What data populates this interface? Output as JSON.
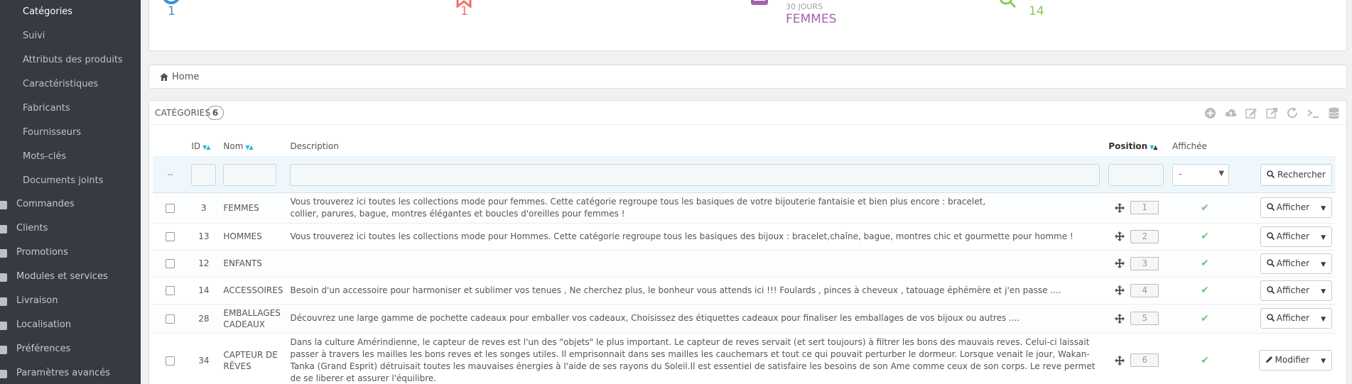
{
  "sidebar": {
    "sub_items": [
      {
        "label": "Catégories",
        "active": true
      },
      {
        "label": "Suivi"
      },
      {
        "label": "Attributs des produits"
      },
      {
        "label": "Caractéristiques"
      },
      {
        "label": "Fabricants"
      },
      {
        "label": "Fournisseurs"
      },
      {
        "label": "Mots-clés"
      },
      {
        "label": "Documents joints"
      }
    ],
    "main_items": [
      {
        "label": "Commandes"
      },
      {
        "label": "Clients"
      },
      {
        "label": "Promotions"
      },
      {
        "label": "Modules et services"
      },
      {
        "label": "Livraison"
      },
      {
        "label": "Localisation"
      },
      {
        "label": "Préférences"
      },
      {
        "label": "Paramètres avancés"
      }
    ]
  },
  "kpi": [
    {
      "icon": "circle-icon",
      "value": "1",
      "color": "#3e8fd0"
    },
    {
      "icon": "bookmark-icon",
      "value": "1",
      "color": "#f36d6b"
    },
    {
      "icon": "calendar-icon",
      "sub": "30 JOURS",
      "value": "FEMMES",
      "color": "#a264ac"
    },
    {
      "icon": "search-icon",
      "value": "14",
      "color": "#8bc954"
    }
  ],
  "breadcrumb": {
    "home": "Home"
  },
  "panel": {
    "title": "CATÉGORIES",
    "count": "6",
    "toolbar": [
      "add-icon",
      "cloud-upload-icon",
      "edit-icon",
      "export-icon",
      "refresh-icon",
      "terminal-icon",
      "database-icon"
    ]
  },
  "table": {
    "headers": {
      "id": "ID",
      "name": "Nom",
      "description": "Description",
      "position": "Position",
      "displayed": "Affichée"
    },
    "filter": {
      "dash": "--",
      "select_value": "-",
      "search_label": "Rechercher"
    },
    "rows": [
      {
        "id": "3",
        "name": "FEMMES",
        "description": "Vous trouverez ici toutes les collections mode pour femmes. Cette catégorie regroupe tous les basiques de votre bijouterie fantaisie et bien plus encore : bracelet, collier, parures, bague, montres élégantes et boucles d'oreilles pour femmes !",
        "position": "1",
        "action": "Afficher",
        "action_icon": "zoom-icon"
      },
      {
        "id": "13",
        "name": "HOMMES",
        "description": "Vous trouverez ici toutes les collections mode pour Hommes. Cette catégorie regroupe tous les basiques des bijoux : bracelet,chaîne, bague, montres chic et gourmette pour homme !",
        "position": "2",
        "action": "Afficher",
        "action_icon": "zoom-icon"
      },
      {
        "id": "12",
        "name": "ENFANTS",
        "description": "",
        "position": "3",
        "action": "Afficher",
        "action_icon": "zoom-icon"
      },
      {
        "id": "14",
        "name": "ACCESSOIRES",
        "description": "Besoin d'un accessoire pour harmoniser et sublimer vos tenues ,  Ne cherchez plus, le bonheur vous attends ici !!! Foulards , pinces à cheveux , tatouage éphémère et j'en passe ....",
        "position": "4",
        "action": "Afficher",
        "action_icon": "zoom-icon"
      },
      {
        "id": "28",
        "name": "EMBALLAGES CADEAUX",
        "description": "Découvrez une large gamme de pochette cadeaux pour emballer vos cadeaux, Choisissez des étiquettes cadeaux pour finaliser les emballages de vos bijoux ou autres ....",
        "position": "5",
        "action": "Afficher",
        "action_icon": "zoom-icon"
      },
      {
        "id": "34",
        "name": "CAPTEUR DE RÊVES",
        "description": "Dans la culture Amérindienne, le capteur de reves est l'un des \"objets\" le plus important. Le capteur de reves servait (et sert toujours) à filtrer les bons des mauvais reves. Celui-ci laissait passer à travers les mailles les bons reves et les songes utiles. Il emprisonnait dans ses mailles les cauchemars et tout ce qui pouvait perturber le dormeur. Lorsque venait le jour, Wakan-Tanka (Grand Esprit) détruisait toutes les mauvaises énergies à l'aide de ses rayons du Soleil.Il est essentiel de satisfaire les besoins de son Ame comme ceux de son corps. Le reve permet de se liberer et assurer l'équilibre.",
        "position": "6",
        "action": "Modifier",
        "action_icon": "pencil-icon"
      }
    ]
  }
}
